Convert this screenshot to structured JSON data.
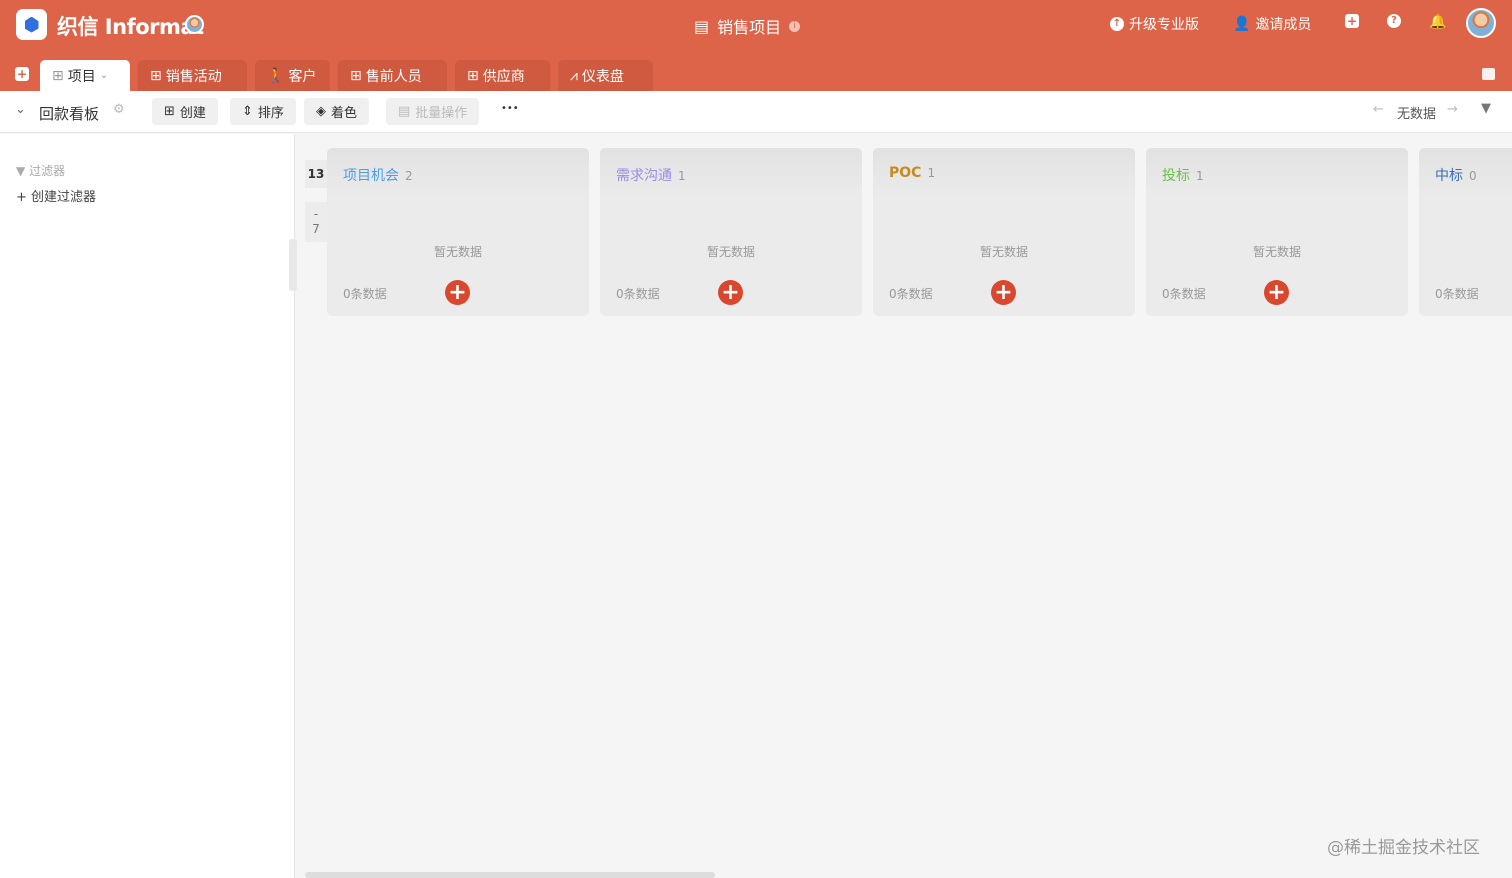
{
  "app": {
    "brand": "织信 Informat",
    "title": "销售项目"
  },
  "header": {
    "upgrade": "升级专业版",
    "invite": "邀请成员"
  },
  "tabs": [
    {
      "label": "项目",
      "icon": "grid-icon"
    },
    {
      "label": "销售活动",
      "icon": "grid-icon"
    },
    {
      "label": "客户",
      "icon": "walk-icon"
    },
    {
      "label": "售前人员",
      "icon": "grid-icon"
    },
    {
      "label": "供应商",
      "icon": "grid-icon"
    },
    {
      "label": "仪表盘",
      "icon": "chart-icon"
    }
  ],
  "toolbar": {
    "view": "回款看板",
    "create": "创建",
    "sort": "排序",
    "color": "着色",
    "batch": "批量操作",
    "more": "•••",
    "nav": "无数据"
  },
  "sidebar": {
    "filter": "过滤器",
    "create_filter": "创建过滤器"
  },
  "group": {
    "count": "13",
    "dash": "-",
    "sub": "7"
  },
  "columns": [
    {
      "title": "项目机会",
      "count": "2",
      "color": "#4a9ee8",
      "empty": "暂无数据",
      "total": "0条数据"
    },
    {
      "title": "需求沟通",
      "count": "1",
      "color": "#9a8de6",
      "empty": "暂无数据",
      "total": "0条数据"
    },
    {
      "title": "POC",
      "count": "1",
      "color": "#c78a1e",
      "empty": "暂无数据",
      "total": "0条数据"
    },
    {
      "title": "投标",
      "count": "1",
      "color": "#6cc04a",
      "empty": "暂无数据",
      "total": "0条数据"
    },
    {
      "title": "中标",
      "count": "0",
      "color": "#3a6fb8",
      "empty": "",
      "total": "0条数据"
    }
  ],
  "watermark": "@稀土掘金技术社区"
}
